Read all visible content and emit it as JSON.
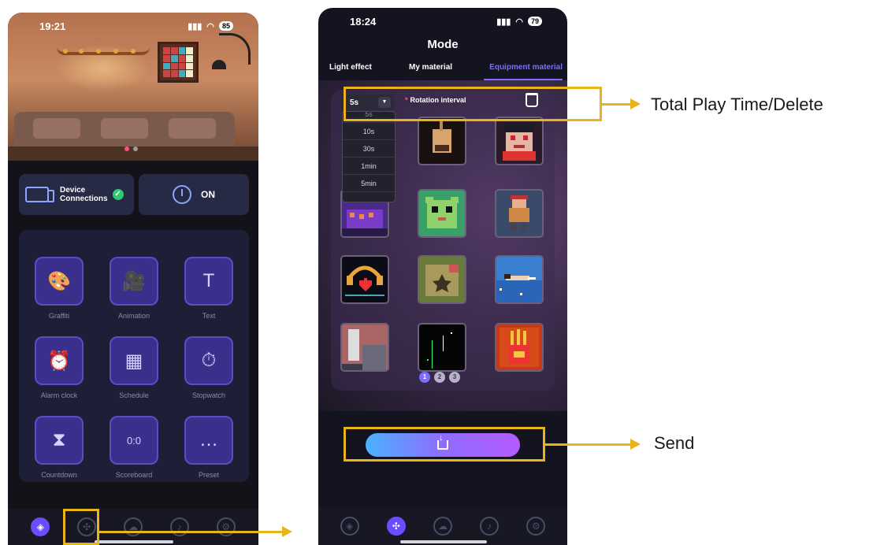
{
  "left_phone": {
    "time": "19:21",
    "battery": "85",
    "device_card": {
      "label_line1": "Device",
      "label_line2": "Connections"
    },
    "power": {
      "label": "ON"
    },
    "tools": [
      {
        "label": "Graffiti",
        "icon": "palette-icon",
        "glyph": "🎨"
      },
      {
        "label": "Animation",
        "icon": "camera-icon",
        "glyph": "🎥"
      },
      {
        "label": "Text",
        "icon": "text-icon",
        "glyph": "T"
      },
      {
        "label": "Alarm clock",
        "icon": "alarm-icon",
        "glyph": "⏰"
      },
      {
        "label": "Schedule",
        "icon": "calendar-icon",
        "glyph": "▦"
      },
      {
        "label": "Stopwatch",
        "icon": "stopwatch-icon",
        "glyph": "⏱"
      },
      {
        "label": "Countdown",
        "icon": "hourglass-icon",
        "glyph": "⧗"
      },
      {
        "label": "Scoreboard",
        "icon": "scoreboard-icon",
        "glyph": "0:0"
      },
      {
        "label": "Preset",
        "icon": "chat-icon",
        "glyph": "…"
      }
    ]
  },
  "right_phone": {
    "time": "18:24",
    "battery": "79",
    "title": "Mode",
    "tabs": [
      "Light effect",
      "My material",
      "Equipment material"
    ],
    "active_tab": "Equipment material",
    "interval_value": "5s",
    "interval_label": "Rotation interval",
    "interval_options": [
      "5s",
      "10s",
      "30s",
      "1min",
      "5min"
    ],
    "pages": [
      "1",
      "2",
      "3"
    ],
    "current_page": "1"
  },
  "annotations": {
    "top": "Total Play Time/Delete",
    "send": "Send"
  },
  "colors": {
    "accent": "#7e6bff",
    "highlight": "#e9b41a",
    "success": "#2fc96f"
  }
}
